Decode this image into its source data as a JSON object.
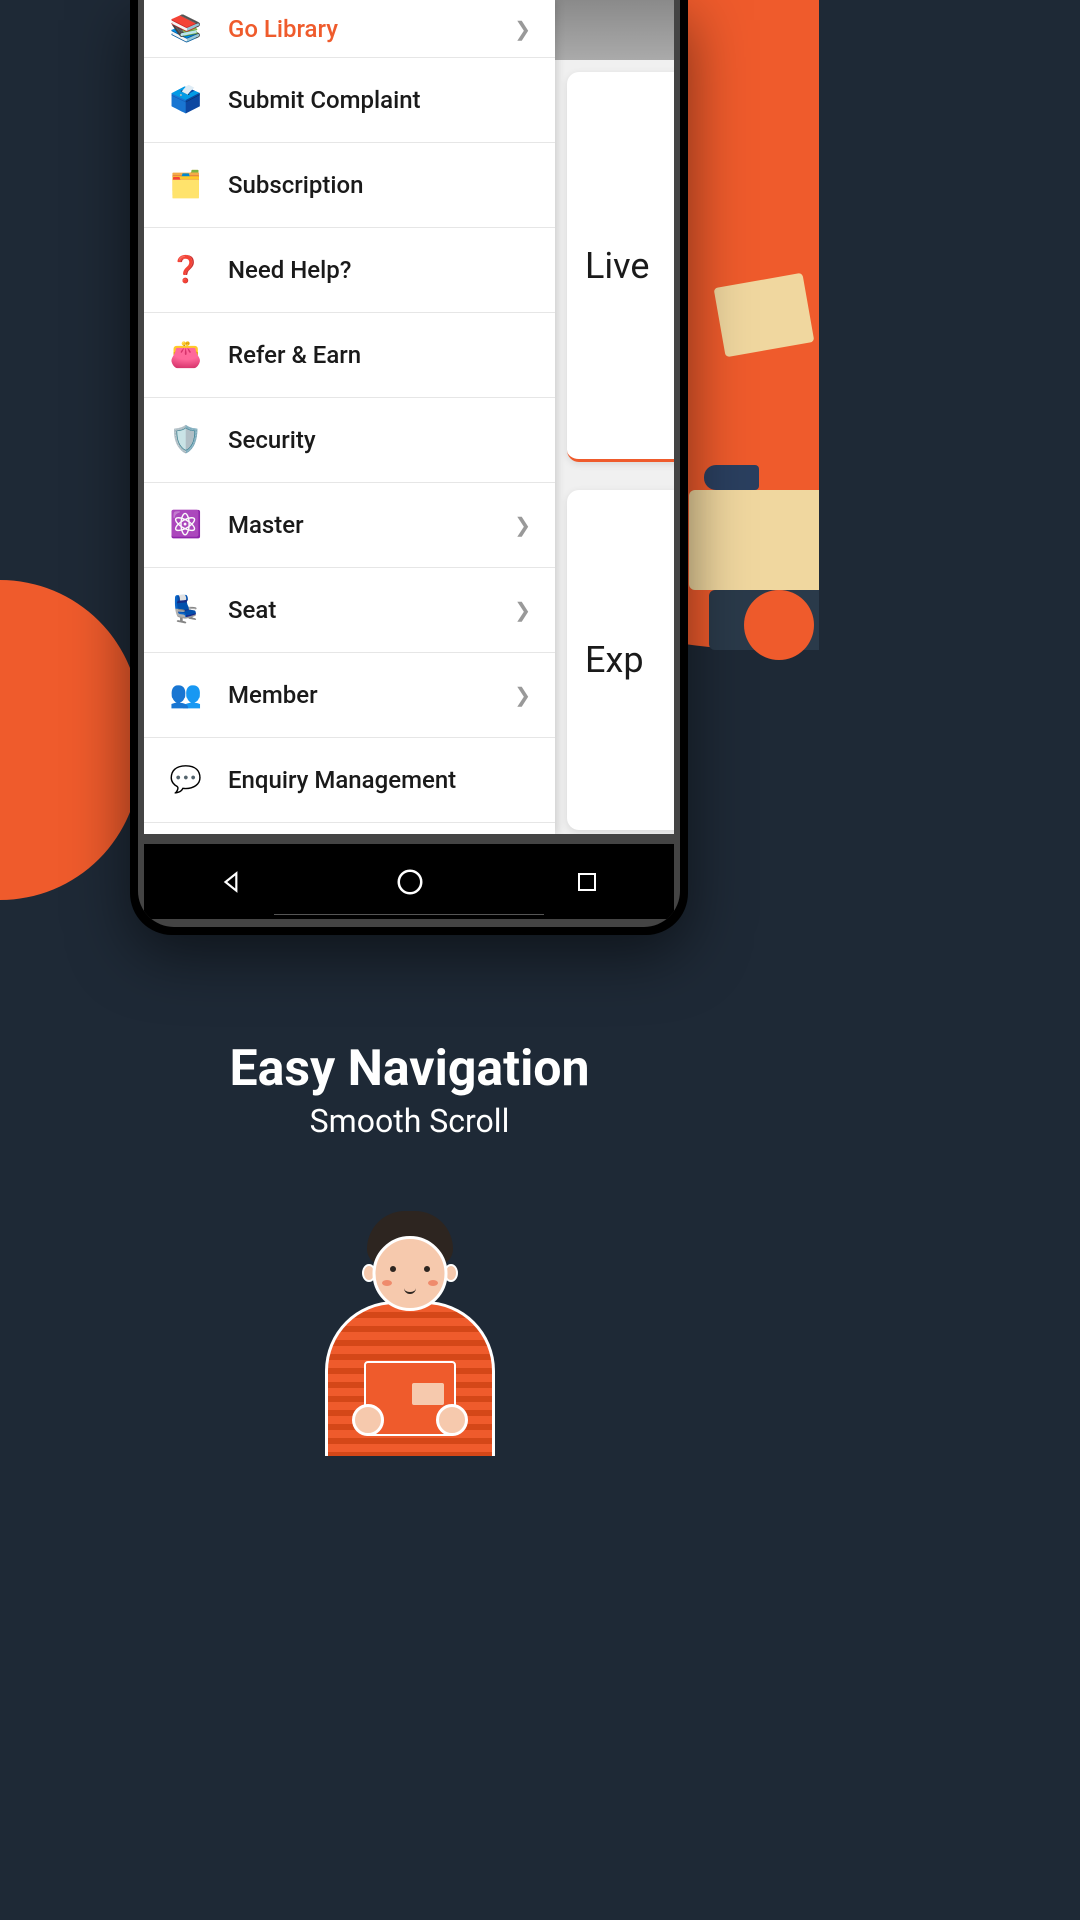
{
  "menu": {
    "items": [
      {
        "label": "Go Library",
        "has_arrow": true,
        "active": true,
        "icon": "📚"
      },
      {
        "label": "Submit Complaint",
        "has_arrow": false,
        "active": false,
        "icon": "🗳️"
      },
      {
        "label": "Subscription",
        "has_arrow": false,
        "active": false,
        "icon": "🗂️"
      },
      {
        "label": "Need Help?",
        "has_arrow": false,
        "active": false,
        "icon": "❓"
      },
      {
        "label": "Refer & Earn",
        "has_arrow": false,
        "active": false,
        "icon": "👛"
      },
      {
        "label": "Security",
        "has_arrow": false,
        "active": false,
        "icon": "🛡️"
      },
      {
        "label": "Master",
        "has_arrow": true,
        "active": false,
        "icon": "⚛️"
      },
      {
        "label": "Seat",
        "has_arrow": true,
        "active": false,
        "icon": "💺"
      },
      {
        "label": "Member",
        "has_arrow": true,
        "active": false,
        "icon": "👥"
      },
      {
        "label": "Enquiry Management",
        "has_arrow": false,
        "active": false,
        "icon": "💬"
      }
    ]
  },
  "background_cards": {
    "card1": "Live",
    "card2": "Exp"
  },
  "caption": {
    "title": "Easy Navigation",
    "subtitle": "Smooth Scroll"
  }
}
